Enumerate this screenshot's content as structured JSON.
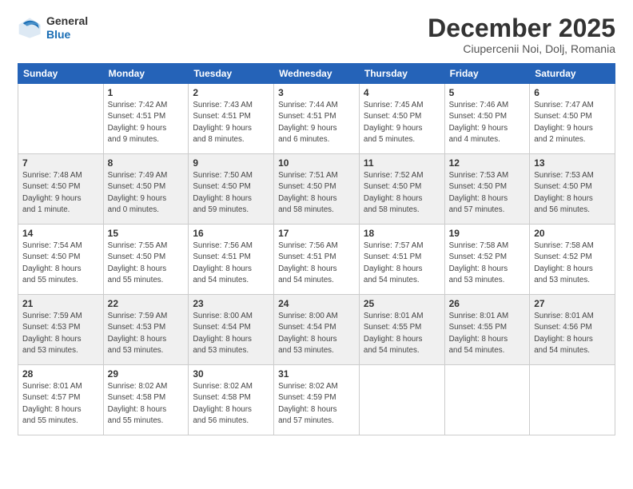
{
  "header": {
    "logo_line1": "General",
    "logo_line2": "Blue",
    "month": "December 2025",
    "location": "Ciupercenii Noi, Dolj, Romania"
  },
  "weekdays": [
    "Sunday",
    "Monday",
    "Tuesday",
    "Wednesday",
    "Thursday",
    "Friday",
    "Saturday"
  ],
  "weeks": [
    [
      {
        "num": "",
        "info": ""
      },
      {
        "num": "1",
        "info": "Sunrise: 7:42 AM\nSunset: 4:51 PM\nDaylight: 9 hours\nand 9 minutes."
      },
      {
        "num": "2",
        "info": "Sunrise: 7:43 AM\nSunset: 4:51 PM\nDaylight: 9 hours\nand 8 minutes."
      },
      {
        "num": "3",
        "info": "Sunrise: 7:44 AM\nSunset: 4:51 PM\nDaylight: 9 hours\nand 6 minutes."
      },
      {
        "num": "4",
        "info": "Sunrise: 7:45 AM\nSunset: 4:50 PM\nDaylight: 9 hours\nand 5 minutes."
      },
      {
        "num": "5",
        "info": "Sunrise: 7:46 AM\nSunset: 4:50 PM\nDaylight: 9 hours\nand 4 minutes."
      },
      {
        "num": "6",
        "info": "Sunrise: 7:47 AM\nSunset: 4:50 PM\nDaylight: 9 hours\nand 2 minutes."
      }
    ],
    [
      {
        "num": "7",
        "info": "Sunrise: 7:48 AM\nSunset: 4:50 PM\nDaylight: 9 hours\nand 1 minute."
      },
      {
        "num": "8",
        "info": "Sunrise: 7:49 AM\nSunset: 4:50 PM\nDaylight: 9 hours\nand 0 minutes."
      },
      {
        "num": "9",
        "info": "Sunrise: 7:50 AM\nSunset: 4:50 PM\nDaylight: 8 hours\nand 59 minutes."
      },
      {
        "num": "10",
        "info": "Sunrise: 7:51 AM\nSunset: 4:50 PM\nDaylight: 8 hours\nand 58 minutes."
      },
      {
        "num": "11",
        "info": "Sunrise: 7:52 AM\nSunset: 4:50 PM\nDaylight: 8 hours\nand 58 minutes."
      },
      {
        "num": "12",
        "info": "Sunrise: 7:53 AM\nSunset: 4:50 PM\nDaylight: 8 hours\nand 57 minutes."
      },
      {
        "num": "13",
        "info": "Sunrise: 7:53 AM\nSunset: 4:50 PM\nDaylight: 8 hours\nand 56 minutes."
      }
    ],
    [
      {
        "num": "14",
        "info": "Sunrise: 7:54 AM\nSunset: 4:50 PM\nDaylight: 8 hours\nand 55 minutes."
      },
      {
        "num": "15",
        "info": "Sunrise: 7:55 AM\nSunset: 4:50 PM\nDaylight: 8 hours\nand 55 minutes."
      },
      {
        "num": "16",
        "info": "Sunrise: 7:56 AM\nSunset: 4:51 PM\nDaylight: 8 hours\nand 54 minutes."
      },
      {
        "num": "17",
        "info": "Sunrise: 7:56 AM\nSunset: 4:51 PM\nDaylight: 8 hours\nand 54 minutes."
      },
      {
        "num": "18",
        "info": "Sunrise: 7:57 AM\nSunset: 4:51 PM\nDaylight: 8 hours\nand 54 minutes."
      },
      {
        "num": "19",
        "info": "Sunrise: 7:58 AM\nSunset: 4:52 PM\nDaylight: 8 hours\nand 53 minutes."
      },
      {
        "num": "20",
        "info": "Sunrise: 7:58 AM\nSunset: 4:52 PM\nDaylight: 8 hours\nand 53 minutes."
      }
    ],
    [
      {
        "num": "21",
        "info": "Sunrise: 7:59 AM\nSunset: 4:53 PM\nDaylight: 8 hours\nand 53 minutes."
      },
      {
        "num": "22",
        "info": "Sunrise: 7:59 AM\nSunset: 4:53 PM\nDaylight: 8 hours\nand 53 minutes."
      },
      {
        "num": "23",
        "info": "Sunrise: 8:00 AM\nSunset: 4:54 PM\nDaylight: 8 hours\nand 53 minutes."
      },
      {
        "num": "24",
        "info": "Sunrise: 8:00 AM\nSunset: 4:54 PM\nDaylight: 8 hours\nand 53 minutes."
      },
      {
        "num": "25",
        "info": "Sunrise: 8:01 AM\nSunset: 4:55 PM\nDaylight: 8 hours\nand 54 minutes."
      },
      {
        "num": "26",
        "info": "Sunrise: 8:01 AM\nSunset: 4:55 PM\nDaylight: 8 hours\nand 54 minutes."
      },
      {
        "num": "27",
        "info": "Sunrise: 8:01 AM\nSunset: 4:56 PM\nDaylight: 8 hours\nand 54 minutes."
      }
    ],
    [
      {
        "num": "28",
        "info": "Sunrise: 8:01 AM\nSunset: 4:57 PM\nDaylight: 8 hours\nand 55 minutes."
      },
      {
        "num": "29",
        "info": "Sunrise: 8:02 AM\nSunset: 4:58 PM\nDaylight: 8 hours\nand 55 minutes."
      },
      {
        "num": "30",
        "info": "Sunrise: 8:02 AM\nSunset: 4:58 PM\nDaylight: 8 hours\nand 56 minutes."
      },
      {
        "num": "31",
        "info": "Sunrise: 8:02 AM\nSunset: 4:59 PM\nDaylight: 8 hours\nand 57 minutes."
      },
      {
        "num": "",
        "info": ""
      },
      {
        "num": "",
        "info": ""
      },
      {
        "num": "",
        "info": ""
      }
    ]
  ]
}
